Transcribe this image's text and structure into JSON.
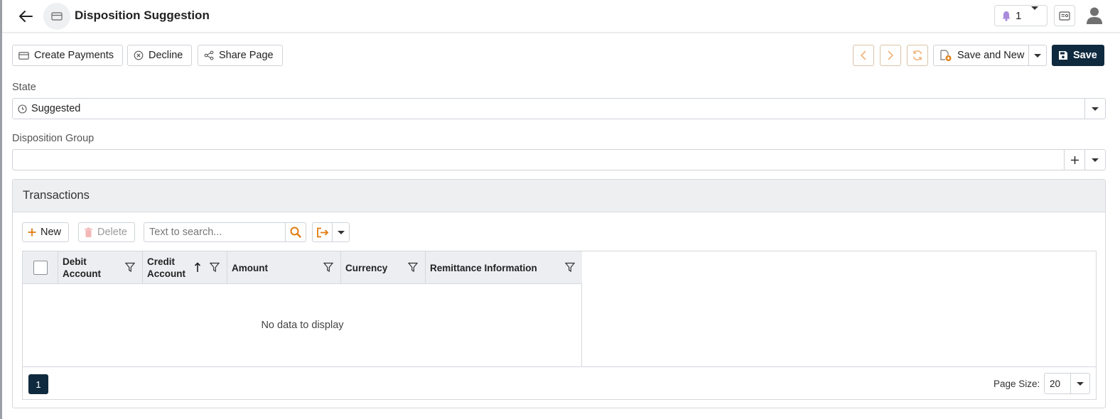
{
  "header": {
    "title": "Disposition Suggestion",
    "notification_count": "1"
  },
  "toolbar": {
    "create_payments": "Create Payments",
    "decline": "Decline",
    "share_page": "Share Page",
    "save_and_new": "Save and New",
    "save": "Save"
  },
  "form": {
    "state_label": "State",
    "state_value": "Suggested",
    "group_label": "Disposition Group",
    "group_value": ""
  },
  "transactions": {
    "title": "Transactions",
    "new_label": "New",
    "delete_label": "Delete",
    "search_placeholder": "Text to search...",
    "columns": [
      "Debit Account",
      "Credit Account",
      "Amount",
      "Currency",
      "Remittance Information"
    ],
    "empty_text": "No data to display",
    "current_page": "1",
    "page_size_label": "Page Size:",
    "page_size": "20"
  },
  "colors": {
    "primary": "#0f2a3f",
    "accent": "#e07b10",
    "notification": "#9b7fd1"
  },
  "icons": {
    "back": "arrow-left-icon",
    "page": "card-icon",
    "notification": "bell-icon",
    "search": "search-icon",
    "export": "export-icon",
    "filter": "filter-icon",
    "sort": "arrow-up-icon"
  }
}
